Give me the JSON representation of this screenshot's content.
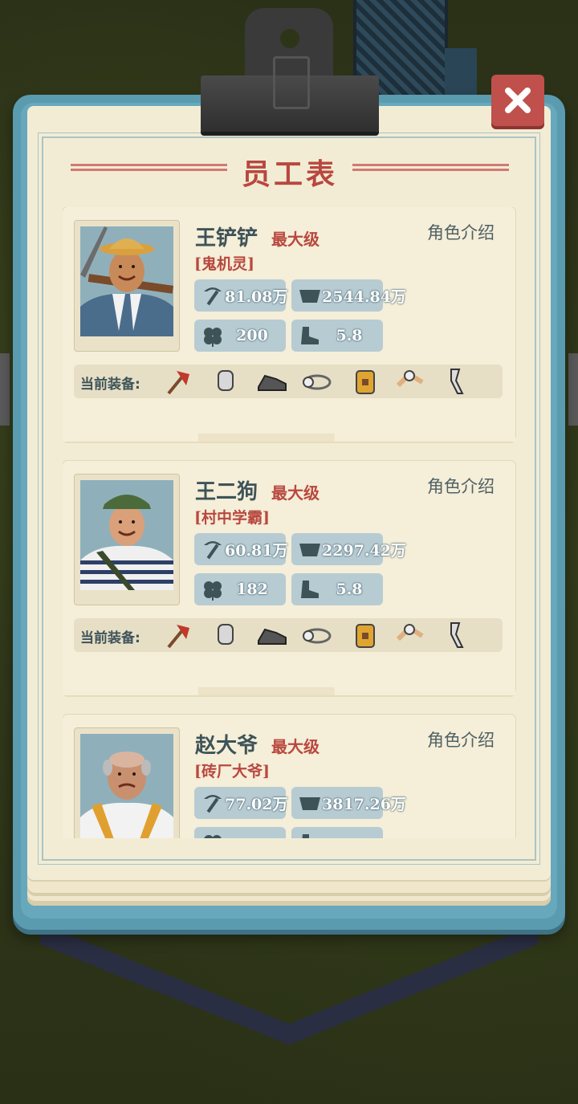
{
  "title": "员工表",
  "close_icon": "close-icon",
  "equipment_label": "当前装备:",
  "intro_label": "角色介绍",
  "colors": {
    "accent_red": "#b8483f",
    "board_blue": "#5b9bb0",
    "paper": "#f3ecd5",
    "stat_bg": "#b7cbd3"
  },
  "employees": [
    {
      "name": "王铲铲",
      "level": "最大级",
      "tag": "[鬼机灵]",
      "mining": "81.08万",
      "carry": "2544.84万",
      "luck": "200",
      "speed": "5.8",
      "equipment": [
        "pickaxe-icon",
        "gloves-icon",
        "shoes-icon",
        "headlamp-icon",
        "backpack-icon",
        "knee-pad-icon",
        "leg-brace-icon"
      ]
    },
    {
      "name": "王二狗",
      "level": "最大级",
      "tag": "[村中学霸]",
      "mining": "60.81万",
      "carry": "2297.42万",
      "luck": "182",
      "speed": "5.8",
      "equipment": [
        "pickaxe-icon",
        "gloves-icon",
        "shoes-icon",
        "headlamp-icon",
        "backpack-icon",
        "knee-pad-icon",
        "leg-brace-icon"
      ]
    },
    {
      "name": "赵大爷",
      "level": "最大级",
      "tag": "[砖厂大爷]",
      "mining": "77.02万",
      "carry": "3817.26万",
      "luck": "",
      "speed": "",
      "equipment": []
    }
  ]
}
